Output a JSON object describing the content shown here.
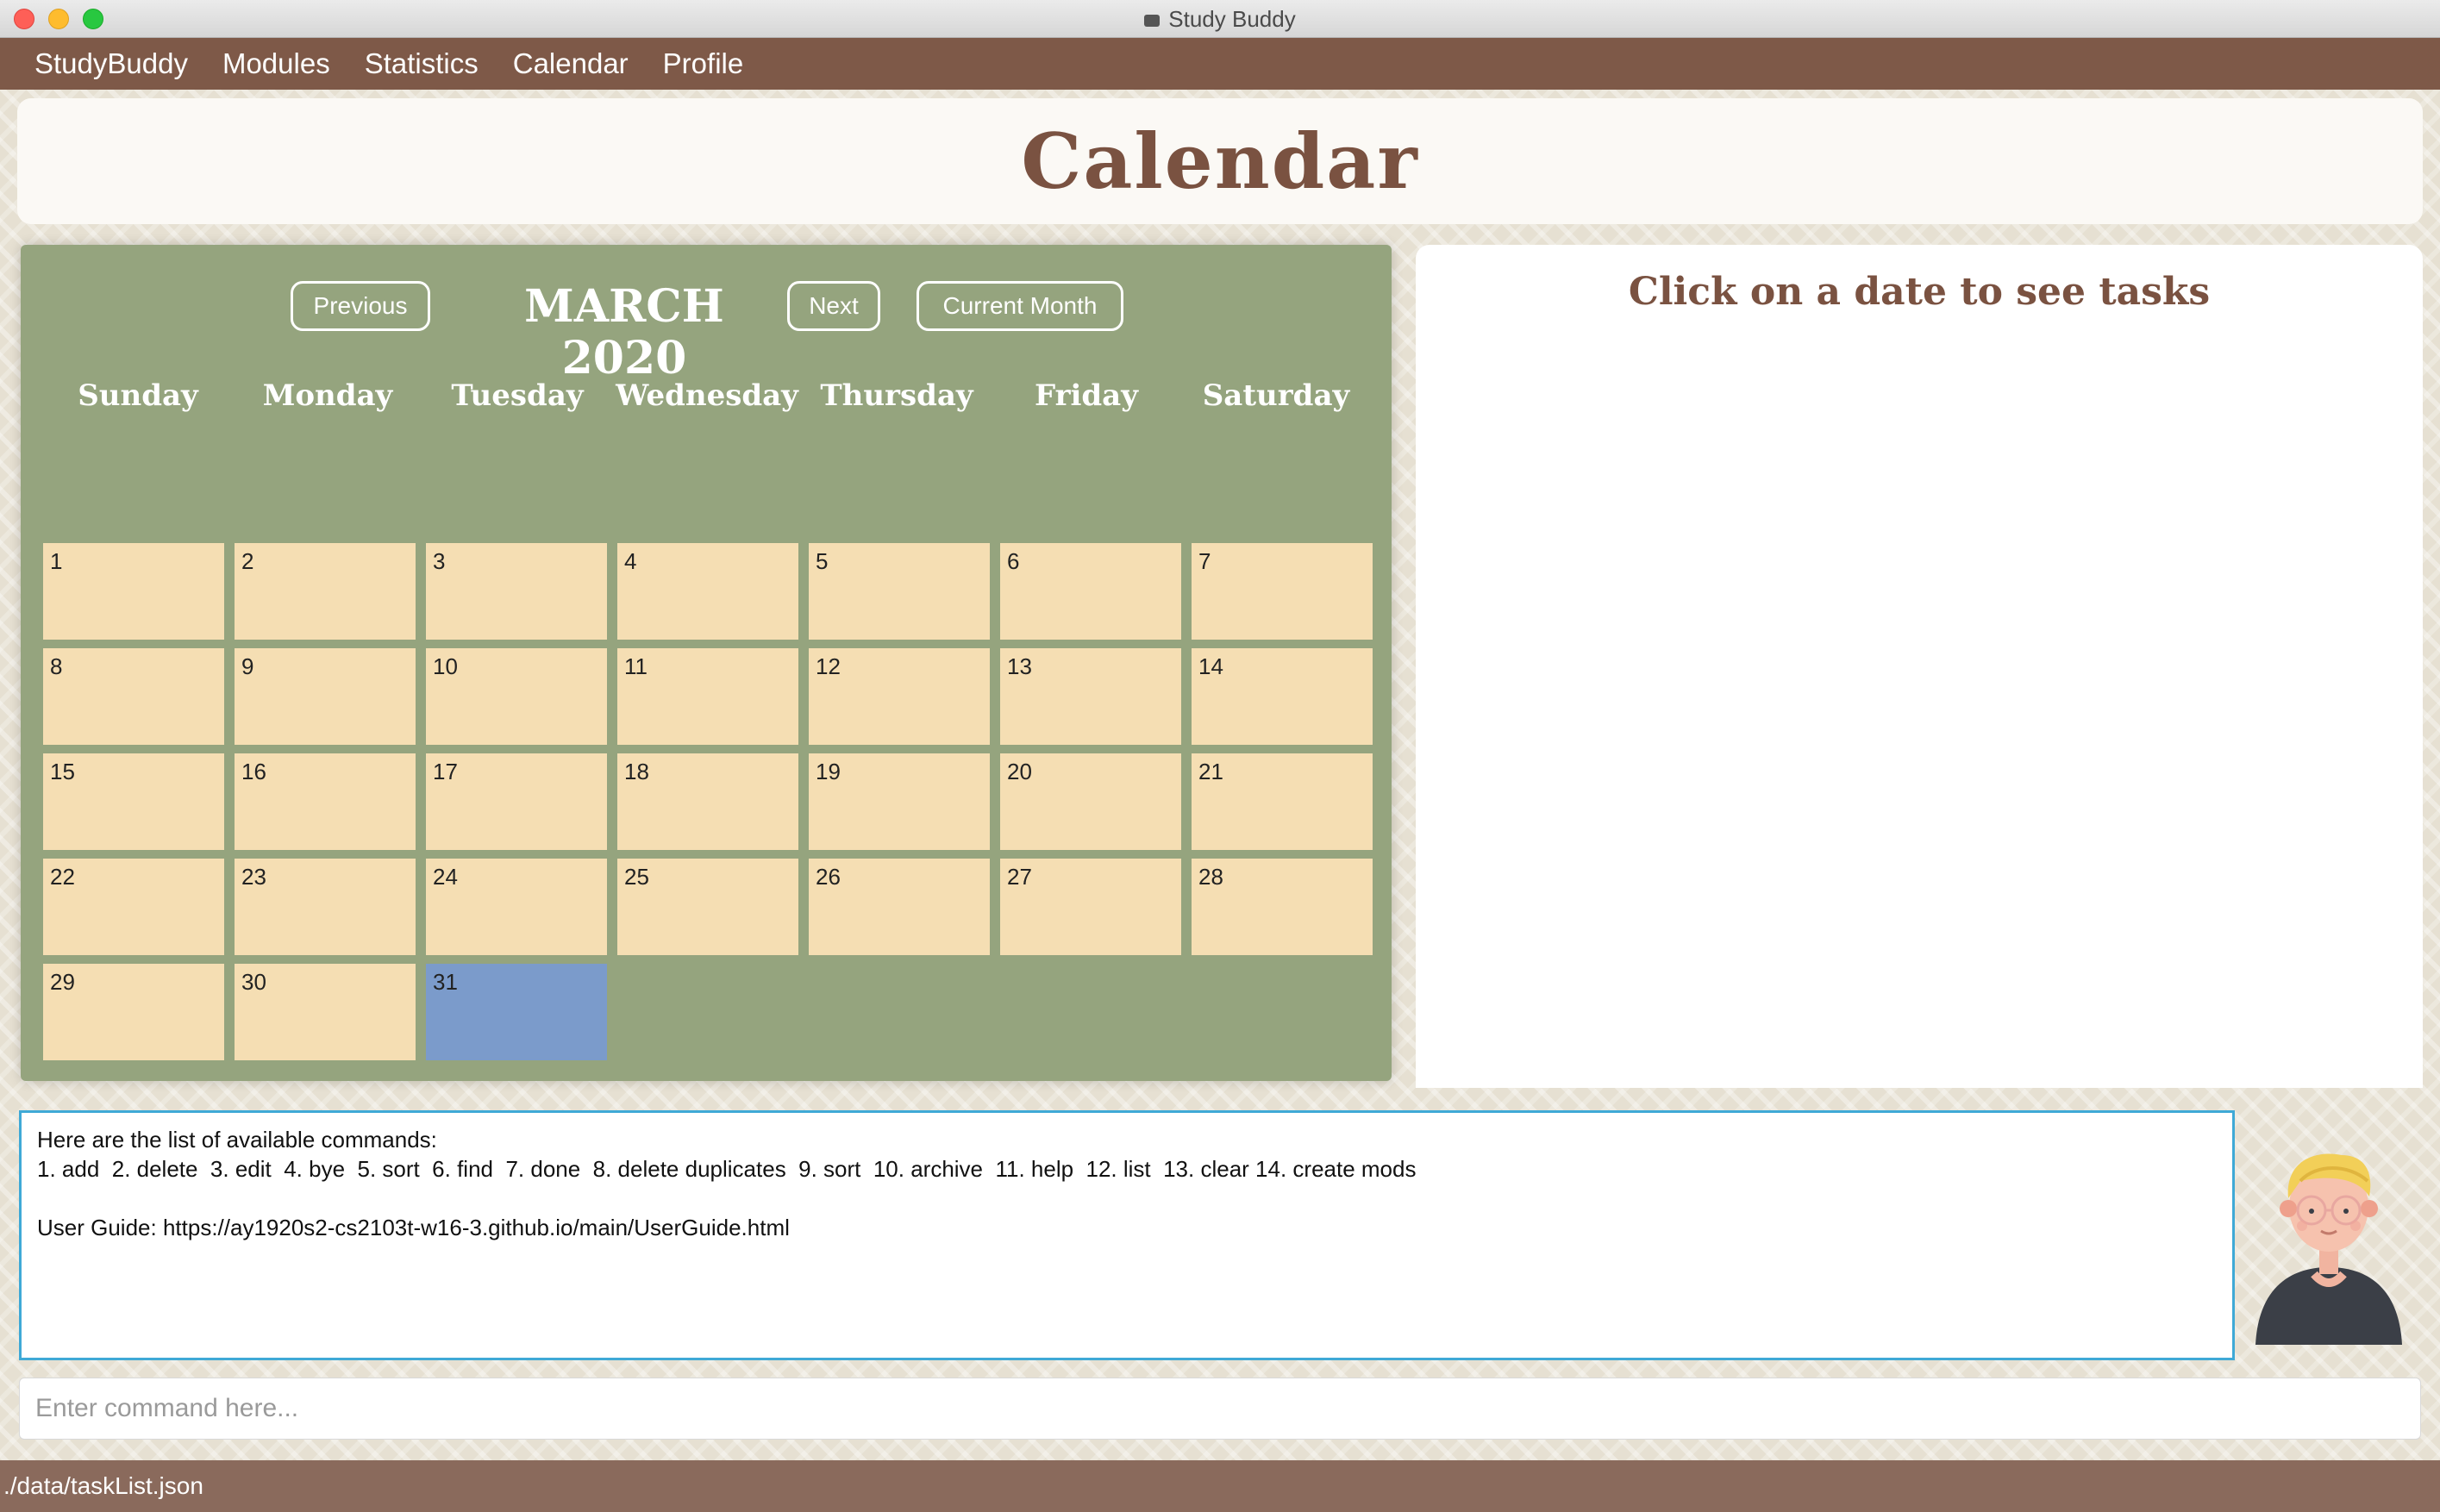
{
  "window": {
    "title": "Study Buddy"
  },
  "menu": [
    "StudyBuddy",
    "Modules",
    "Statistics",
    "Calendar",
    "Profile"
  ],
  "page": {
    "title": "Calendar"
  },
  "calendar": {
    "previous_label": "Previous",
    "month_label": "MARCH 2020",
    "next_label": "Next",
    "current_month_label": "Current Month",
    "weekdays": [
      "Sunday",
      "Monday",
      "Tuesday",
      "Wednesday",
      "Thursday",
      "Friday",
      "Saturday"
    ],
    "first_weekday_index": 0,
    "days_in_month": 31,
    "selected_day": "31",
    "selected_color": "#7b9bcb",
    "cell_color": "#f5deb3",
    "panel_color": "#95a47e"
  },
  "tasks": {
    "heading": "Click on a date to see tasks"
  },
  "output": {
    "lines": [
      "Here are the list of available commands:",
      "1. add  2. delete  3. edit  4. bye  5. sort  6. find  7. done  8. delete duplicates  9. sort  10. archive  11. help  12. list  13. clear 14. create mods",
      "",
      "User Guide: https://ay1920s2-cs2103t-w16-3.github.io/main/UserGuide.html"
    ]
  },
  "command": {
    "placeholder": "Enter command here..."
  },
  "status": {
    "path": "./data/taskList.json"
  },
  "colors": {
    "menubar": "#7e5948",
    "accent_brown": "#7a5241",
    "statusbar": "#8a6a5c",
    "focus_border": "#3fa9d6"
  }
}
